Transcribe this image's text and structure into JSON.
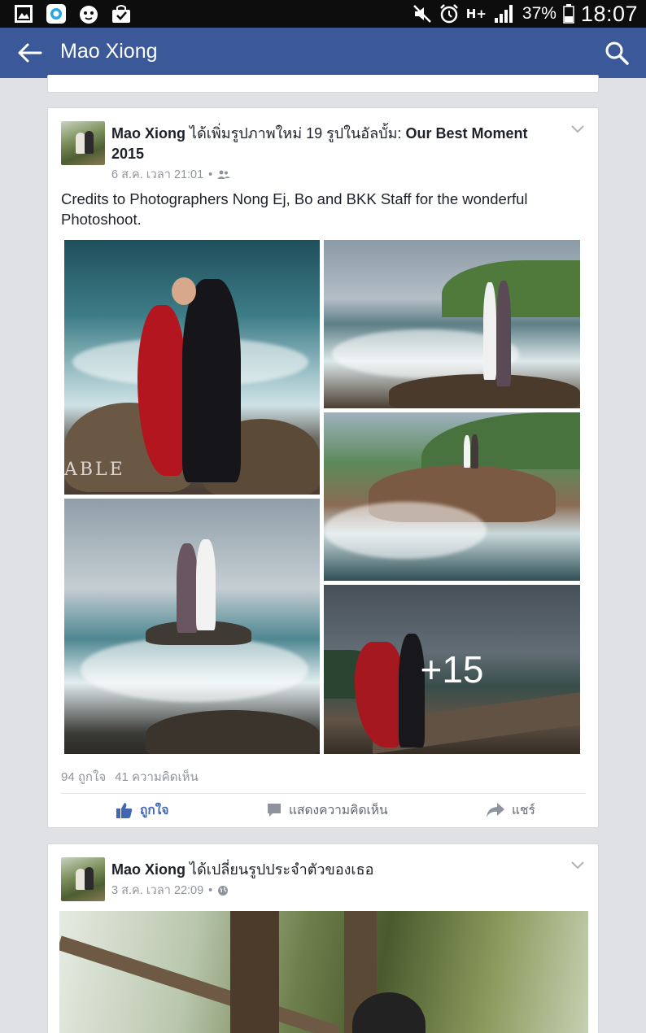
{
  "status_bar": {
    "battery": "37%",
    "time": "18:07",
    "network": "H+",
    "icons": [
      "gallery-icon",
      "app-icon",
      "lion-icon",
      "shopping-bag-icon",
      "mute-icon",
      "alarm-icon",
      "network-icon",
      "signal-icon",
      "battery-icon"
    ]
  },
  "app_bar": {
    "title": "Mao Xiong",
    "back_icon": "back-arrow-icon",
    "search_icon": "search-icon",
    "color": "#3b5998"
  },
  "post1": {
    "author": "Mao Xiong",
    "action": "ได้เพิ่มรูปภาพใหม่ 19 รูปในอัลบั้ม:",
    "album": "Our Best Moment 2015",
    "time": "6 ส.ค. เวลา 21:01",
    "audience_icon": "friends-icon",
    "text": "Credits to Photographers Nong Ej, Bo and BKK Staff for the wonderful Photoshoot.",
    "more_photos": "+15",
    "watermark": "ABLE",
    "likes": "94 ถูกใจ",
    "comments": "41 ความคิดเห็น",
    "like_label": "ถูกใจ",
    "comment_label": "แสดงความคิดเห็น",
    "share_label": "แชร์"
  },
  "post2": {
    "author": "Mao Xiong",
    "action": "ได้เปลี่ยนรูปประจำตัวของเธอ",
    "time": "3 ส.ค. เวลา 22:09",
    "audience_icon": "globe-icon"
  },
  "colors": {
    "brand": "#3b5998",
    "like_blue": "#4267b2",
    "meta_gray": "#90949c"
  }
}
